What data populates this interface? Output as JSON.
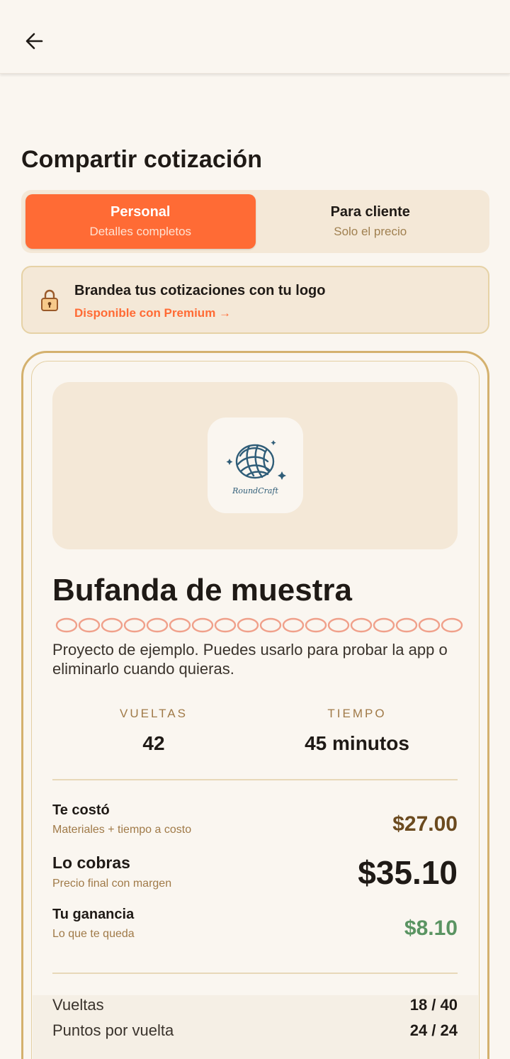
{
  "header": {
    "back_icon": "arrow-left-icon"
  },
  "page_title": "Compartir cotización",
  "mode_tabs": [
    {
      "title": "Personal",
      "subtitle": "Detalles completos",
      "selected": true
    },
    {
      "title": "Para cliente",
      "subtitle": "Solo el precio",
      "selected": false
    }
  ],
  "premium_banner": {
    "icon": "lock-icon",
    "title": "Brandea tus cotizaciones con tu logo",
    "link": "Disponible con Premium →"
  },
  "quote": {
    "logo_text": "RoundCraft",
    "project_title": "Bufanda de muestra",
    "description": "Proyecto de ejemplo. Puedes usarlo para probar la app o eliminarlo cuando quieras.",
    "stats": [
      {
        "label": "VUELTAS",
        "value": "42"
      },
      {
        "label": "TIEMPO",
        "value": "45 minutos"
      }
    ],
    "pricing": [
      {
        "label": "Te costó",
        "sub": "Materiales + tiempo a costo",
        "value": "$27.00",
        "color": "#6b4a1f"
      },
      {
        "label": "Lo cobras",
        "sub": "Precio final con margen",
        "value": "$35.10",
        "color": "#1f1a16"
      },
      {
        "label": "Tu ganancia",
        "sub": "Lo que te queda",
        "value": "$8.10",
        "color": "#5a9462"
      }
    ],
    "footer_rows": [
      {
        "label": "Vueltas",
        "value": "18 / 40"
      },
      {
        "label": "Puntos por vuelta",
        "value": "24 / 24"
      }
    ]
  },
  "colors": {
    "accent": "#ff6b35",
    "background": "#faf6f0",
    "panel": "#f4e8d7",
    "card_border": "#d4b16e",
    "profit": "#5a9462"
  }
}
